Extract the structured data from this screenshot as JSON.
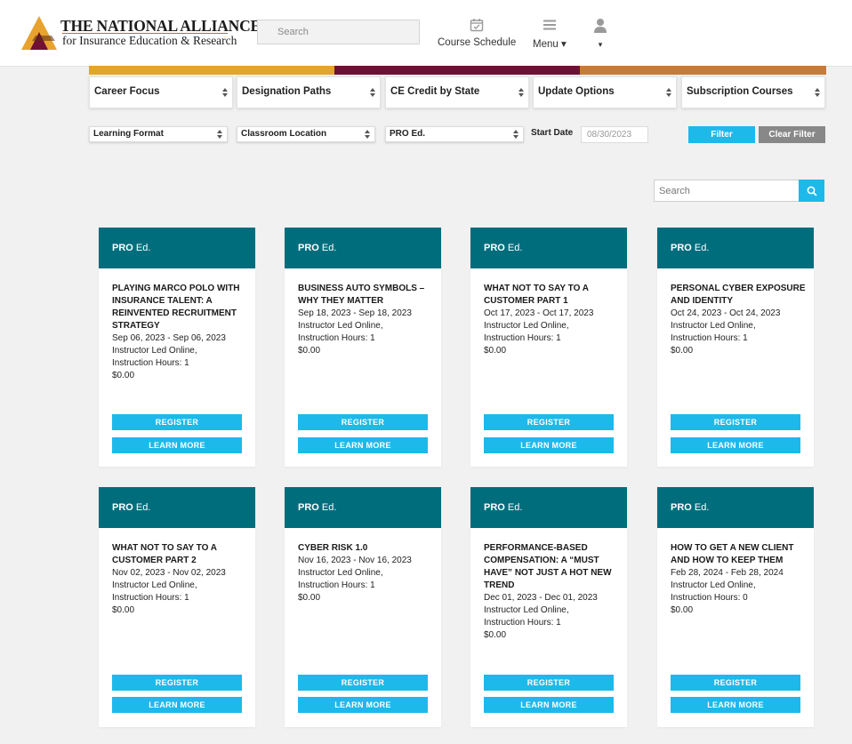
{
  "header": {
    "logo": {
      "line1": "THE NATIONAL ALLIANCE",
      "line2": "for Insurance Education & Research"
    },
    "search_placeholder": "Search",
    "nav": [
      {
        "label": "Course Schedule",
        "icon": "calendar-check-icon"
      },
      {
        "label": "Menu ▾",
        "icon": "hamburger-icon"
      },
      {
        "label": "▾",
        "icon": "user-icon"
      }
    ]
  },
  "colors": {
    "accent": "#1db9ea",
    "card_header": "#006d7d",
    "bar1": "#e8a22e",
    "bar2": "#720f35",
    "bar3": "#c97b36",
    "clear": "#888888"
  },
  "filters_row1": [
    "Career Focus",
    "Designation Paths",
    "CE Credit by State",
    "Update Options",
    "Subscription Courses"
  ],
  "filters_row2": [
    "Learning Format",
    "Classroom Location",
    "PRO Ed."
  ],
  "start_date": {
    "label": "Start Date",
    "value": "08/30/2023"
  },
  "buttons": {
    "filter": "Filter",
    "clear": "Clear Filter"
  },
  "course_search": {
    "placeholder": "Search"
  },
  "card_labels": {
    "brand_bold": "PRO",
    "brand_rest": " Ed.",
    "register": "REGISTER",
    "learn_more": "LEARN MORE"
  },
  "courses": [
    {
      "title": "PLAYING MARCO POLO WITH INSURANCE TALENT: A REINVENTED RECRUITMENT STRATEGY",
      "dates": "Sep 06, 2023 - Sep 06, 2023",
      "format": "Instructor Led Online,",
      "hours": "Instruction Hours: 1",
      "price": "$0.00"
    },
    {
      "title": "BUSINESS AUTO SYMBOLS – WHY THEY MATTER",
      "dates": "Sep 18, 2023 - Sep 18, 2023",
      "format": "Instructor Led Online,",
      "hours": "Instruction Hours: 1",
      "price": "$0.00"
    },
    {
      "title": "WHAT NOT TO SAY TO A CUSTOMER PART 1",
      "dates": "Oct 17, 2023 - Oct 17, 2023",
      "format": "Instructor Led Online,",
      "hours": "Instruction Hours: 1",
      "price": "$0.00"
    },
    {
      "title": "PERSONAL CYBER EXPOSURE AND IDENTITY",
      "dates": "Oct 24, 2023 - Oct 24, 2023",
      "format": "Instructor Led Online,",
      "hours": "Instruction Hours: 1",
      "price": "$0.00"
    },
    {
      "title": "WHAT NOT TO SAY TO A CUSTOMER PART 2",
      "dates": "Nov 02, 2023 - Nov 02, 2023",
      "format": "Instructor Led Online,",
      "hours": "Instruction Hours: 1",
      "price": "$0.00"
    },
    {
      "title": "CYBER RISK 1.0",
      "dates": "Nov 16, 2023 - Nov 16, 2023",
      "format": "Instructor Led Online,",
      "hours": "Instruction Hours: 1",
      "price": "$0.00"
    },
    {
      "title": "PERFORMANCE-BASED COMPENSATION: A “MUST HAVE” NOT JUST A HOT NEW TREND",
      "dates": "Dec 01, 2023 - Dec 01, 2023",
      "format": "Instructor Led Online,",
      "hours": "Instruction Hours: 1",
      "price": "$0.00"
    },
    {
      "title": "HOW TO GET A NEW CLIENT AND HOW TO KEEP THEM",
      "dates": "Feb 28, 2024 - Feb 28, 2024",
      "format": "Instructor Led Online,",
      "hours": "Instruction Hours: 0",
      "price": "$0.00"
    }
  ]
}
